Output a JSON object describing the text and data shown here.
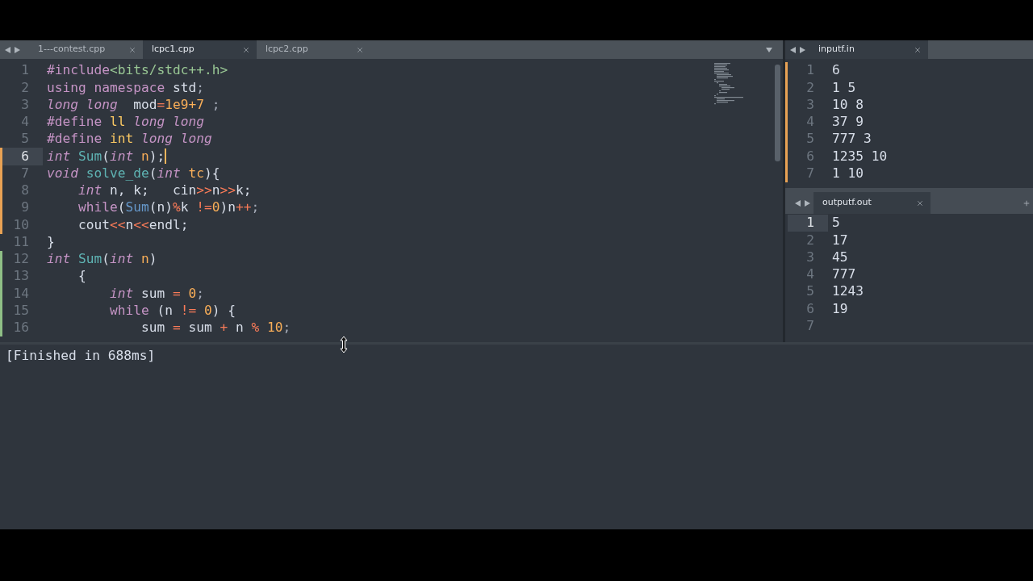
{
  "left_pane": {
    "tabs": [
      {
        "label": "1---contest.cpp",
        "selected": false
      },
      {
        "label": "lcpc1.cpp",
        "selected": true
      },
      {
        "label": "lcpc2.cpp",
        "selected": false
      }
    ],
    "editor": {
      "focused": true,
      "lines": [
        {
          "number": "1",
          "current": false,
          "kind": "unchanged",
          "tokens": [
            {
              "text": "#include",
              "kind": "keyword"
            },
            {
              "text": "<bits/stdc++.h>",
              "kind": "string"
            }
          ]
        },
        {
          "number": "2",
          "current": false,
          "kind": "unchanged",
          "tokens": [
            {
              "text": "using namespace",
              "kind": "keyword"
            },
            {
              "text": " std",
              "kind": "plain"
            },
            {
              "text": ";",
              "kind": "punct"
            }
          ]
        },
        {
          "number": "3",
          "current": false,
          "kind": "unchanged",
          "tokens": [
            {
              "text": "long long",
              "kind": "type"
            },
            {
              "text": "  mod",
              "kind": "plain"
            },
            {
              "text": "=",
              "kind": "operator"
            },
            {
              "text": "1e9+7",
              "kind": "number"
            },
            {
              "text": " ;",
              "kind": "punct"
            }
          ]
        },
        {
          "number": "4",
          "current": false,
          "kind": "unchanged",
          "tokens": [
            {
              "text": "#define",
              "kind": "keyword"
            },
            {
              "text": " ll",
              "kind": "macro"
            },
            {
              "text": " long long",
              "kind": "type"
            }
          ]
        },
        {
          "number": "5",
          "current": false,
          "kind": "unchanged",
          "tokens": [
            {
              "text": "#define",
              "kind": "keyword"
            },
            {
              "text": " int",
              "kind": "macro"
            },
            {
              "text": " long long",
              "kind": "type"
            }
          ]
        },
        {
          "number": "6",
          "current": true,
          "kind": "modified",
          "tokens": [
            {
              "text": "int",
              "kind": "type"
            },
            {
              "text": " Sum",
              "kind": "function"
            },
            {
              "text": "(",
              "kind": "plain"
            },
            {
              "text": "int",
              "kind": "type"
            },
            {
              "text": " n",
              "kind": "param"
            },
            {
              "text": ");",
              "kind": "plain"
            }
          ]
        },
        {
          "number": "7",
          "current": false,
          "kind": "modified",
          "tokens": [
            {
              "text": "void",
              "kind": "type"
            },
            {
              "text": " solve_de",
              "kind": "function"
            },
            {
              "text": "(",
              "kind": "plain"
            },
            {
              "text": "int",
              "kind": "type"
            },
            {
              "text": " tc",
              "kind": "param"
            },
            {
              "text": "){",
              "kind": "plain"
            }
          ]
        },
        {
          "number": "8",
          "current": false,
          "kind": "modified",
          "tokens": [
            {
              "text": "    int",
              "kind": "type"
            },
            {
              "text": " n, k;   cin",
              "kind": "plain"
            },
            {
              "text": ">>",
              "kind": "operator"
            },
            {
              "text": "n",
              "kind": "plain"
            },
            {
              "text": ">>",
              "kind": "operator"
            },
            {
              "text": "k;",
              "kind": "plain"
            }
          ]
        },
        {
          "number": "9",
          "current": false,
          "kind": "modified",
          "tokens": [
            {
              "text": "    while",
              "kind": "keyword"
            },
            {
              "text": "(",
              "kind": "plain"
            },
            {
              "text": "Sum",
              "kind": "call"
            },
            {
              "text": "(n)",
              "kind": "plain"
            },
            {
              "text": "%",
              "kind": "operator"
            },
            {
              "text": "k ",
              "kind": "plain"
            },
            {
              "text": "!=",
              "kind": "operator"
            },
            {
              "text": "0",
              "kind": "number"
            },
            {
              "text": ")n",
              "kind": "plain"
            },
            {
              "text": "++",
              "kind": "operator"
            },
            {
              "text": ";",
              "kind": "punct"
            }
          ]
        },
        {
          "number": "10",
          "current": false,
          "kind": "modified",
          "tokens": [
            {
              "text": "    cout",
              "kind": "plain"
            },
            {
              "text": "<<",
              "kind": "operator"
            },
            {
              "text": "n",
              "kind": "plain"
            },
            {
              "text": "<<",
              "kind": "operator"
            },
            {
              "text": "endl;",
              "kind": "plain"
            }
          ]
        },
        {
          "number": "11",
          "current": false,
          "kind": "unchanged",
          "tokens": [
            {
              "text": "}",
              "kind": "plain"
            }
          ]
        },
        {
          "number": "12",
          "current": false,
          "kind": "added",
          "tokens": [
            {
              "text": "int",
              "kind": "type"
            },
            {
              "text": " Sum",
              "kind": "function"
            },
            {
              "text": "(",
              "kind": "plain"
            },
            {
              "text": "int",
              "kind": "type"
            },
            {
              "text": " n",
              "kind": "param"
            },
            {
              "text": ")",
              "kind": "plain"
            }
          ]
        },
        {
          "number": "13",
          "current": false,
          "kind": "added",
          "tokens": [
            {
              "text": "    {",
              "kind": "plain"
            }
          ]
        },
        {
          "number": "14",
          "current": false,
          "kind": "added",
          "tokens": [
            {
              "text": "        int",
              "kind": "type"
            },
            {
              "text": " sum ",
              "kind": "plain"
            },
            {
              "text": "=",
              "kind": "operator"
            },
            {
              "text": " 0",
              "kind": "number"
            },
            {
              "text": ";",
              "kind": "punct"
            }
          ]
        },
        {
          "number": "15",
          "current": false,
          "kind": "added",
          "tokens": [
            {
              "text": "        while",
              "kind": "keyword"
            },
            {
              "text": " (n ",
              "kind": "plain"
            },
            {
              "text": "!=",
              "kind": "operator"
            },
            {
              "text": " 0",
              "kind": "number"
            },
            {
              "text": ") {",
              "kind": "plain"
            }
          ]
        },
        {
          "number": "16",
          "current": false,
          "kind": "added",
          "tokens": [
            {
              "text": "            sum ",
              "kind": "plain"
            },
            {
              "text": "=",
              "kind": "operator"
            },
            {
              "text": " sum ",
              "kind": "plain"
            },
            {
              "text": "+",
              "kind": "operator"
            },
            {
              "text": " n ",
              "kind": "plain"
            },
            {
              "text": "%",
              "kind": "operator"
            },
            {
              "text": " 10",
              "kind": "number"
            },
            {
              "text": ";",
              "kind": "punct"
            }
          ]
        }
      ]
    }
  },
  "right_top_pane": {
    "tabs": [
      {
        "label": "inputf.in",
        "selected": true
      }
    ],
    "editor": {
      "lines": [
        {
          "number": "1",
          "current": false,
          "kind": "modified",
          "text": "6"
        },
        {
          "number": "2",
          "current": false,
          "kind": "modified",
          "text": "1 5"
        },
        {
          "number": "3",
          "current": false,
          "kind": "modified",
          "text": "10 8"
        },
        {
          "number": "4",
          "current": false,
          "kind": "modified",
          "text": "37 9"
        },
        {
          "number": "5",
          "current": false,
          "kind": "modified",
          "text": "777 3"
        },
        {
          "number": "6",
          "current": false,
          "kind": "modified",
          "text": "1235 10"
        },
        {
          "number": "7",
          "current": false,
          "kind": "modified",
          "text": "1 10"
        }
      ]
    }
  },
  "right_bottom_pane": {
    "tabs": [
      {
        "label": "outputf.out",
        "selected": true
      }
    ],
    "editor": {
      "lines": [
        {
          "number": "1",
          "current": true,
          "text": "5"
        },
        {
          "number": "2",
          "current": false,
          "text": "17"
        },
        {
          "number": "3",
          "current": false,
          "text": "45"
        },
        {
          "number": "4",
          "current": false,
          "text": "777"
        },
        {
          "number": "5",
          "current": false,
          "text": "1243"
        },
        {
          "number": "6",
          "current": false,
          "text": "19"
        },
        {
          "number": "7",
          "current": false
        }
      ]
    }
  },
  "output_panel": {
    "text": "[Finished in 688ms]"
  }
}
